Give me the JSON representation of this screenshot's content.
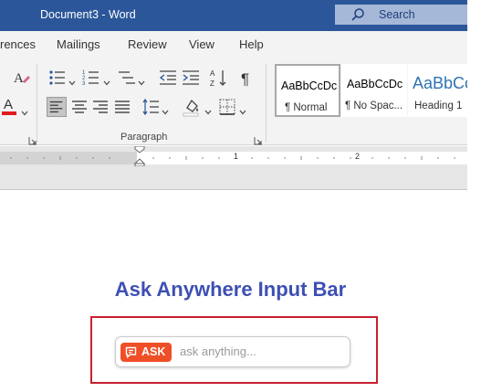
{
  "app": {
    "title": "Document3  -  Word",
    "search_label": "Search"
  },
  "tabs": [
    {
      "label": "rences"
    },
    {
      "label": "Mailings"
    },
    {
      "label": "Review"
    },
    {
      "label": "View"
    },
    {
      "label": "Help"
    }
  ],
  "ribbon": {
    "paragraph_group_label": "Paragraph",
    "font_color_letter": "A",
    "styles": [
      {
        "sample": "AaBbCcDc",
        "name": "¶ Normal"
      },
      {
        "sample": "AaBbCcDc",
        "name": "¶ No Spac..."
      },
      {
        "sample": "AaBbCc",
        "name": "Heading 1"
      }
    ]
  },
  "ruler": {
    "labels": [
      "1",
      "2"
    ]
  },
  "ask_bar": {
    "heading": "Ask Anywhere Input Bar",
    "chip_label": "ASK",
    "placeholder": "ask anything..."
  },
  "colors": {
    "title_bar": "#2b579a",
    "heading": "#3e4fb3",
    "chip": "#ef4f27",
    "highlight_frame": "#c8202f"
  },
  "icons": {
    "search": "magnifier-icon",
    "ask_chip": "chat-bubble-icon"
  }
}
